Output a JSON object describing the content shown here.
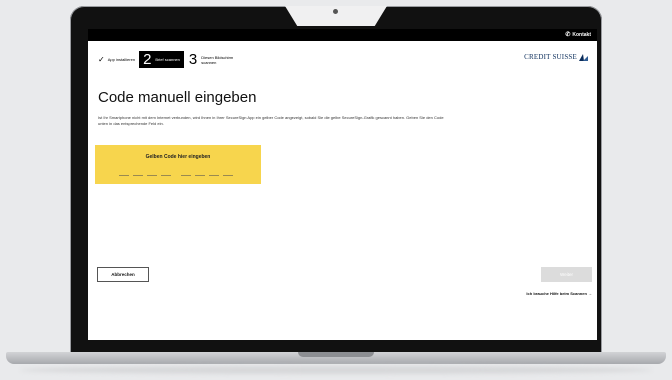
{
  "header": {
    "contact_label": "Kontakt",
    "contact_icon": "phone-icon"
  },
  "steps": [
    {
      "label": "App installieren",
      "state": "done"
    },
    {
      "number": "2",
      "label": "Brief scannen",
      "state": "active"
    },
    {
      "number": "3",
      "label": "Diesen Bildschirm scannen",
      "state": "upcoming"
    }
  ],
  "brand": {
    "logo_text": "CREDIT SUISSE",
    "color": "#0a2c5a"
  },
  "main": {
    "title": "Code manuell eingeben",
    "description": "Ist Ihr Smartphone nicht mit dem Internet verbunden, wird Ihnen in Ihrer SecureSign App ein gelber Code angezeigt, sobald Sie die gelbe SecureSign-Grafik gescannt haben. Geben Sie den Code unten in das entsprechende Feld ein.",
    "code_input": {
      "label": "Gelben Code hier eingeben",
      "background": "#f7d54d"
    }
  },
  "actions": {
    "cancel_label": "Abbrechen",
    "next_label": "Weiter",
    "help_link": "Ich brauche Hilfe beim Scannen →"
  }
}
